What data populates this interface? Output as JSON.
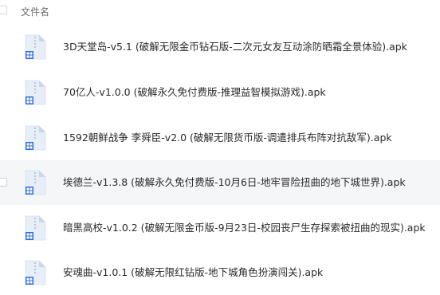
{
  "header": {
    "column_label": "文件名"
  },
  "files": [
    {
      "name": "3D天堂岛-v5.1 (破解无限金币钻石版-二次元女友互动涂防晒霜全景体验).apk",
      "icon": "apk-file-icon"
    },
    {
      "name": "70亿人-v1.0.0 (破解永久免付费版-推理益智模拟游戏).apk",
      "icon": "apk-file-icon"
    },
    {
      "name": "1592朝鲜战争 李舜臣-v2.0 (破解无限货币版-调遣排兵布阵对抗敌军).apk",
      "icon": "apk-file-icon"
    },
    {
      "name": "埃德兰-v1.3.8 (破解永久免付费版-10月6日-地牢冒险扭曲的地下城世界).apk",
      "icon": "apk-file-icon"
    },
    {
      "name": "暗黑高校-v1.0.2 (破解无限金币版-9月23日-校园丧尸生存探索被扭曲的现实).apk",
      "icon": "apk-file-icon"
    },
    {
      "name": "安魂曲-v1.0.1 (破解无限红钻版-地下城角色扮演闯关).apk",
      "icon": "apk-file-icon"
    }
  ],
  "colors": {
    "icon_body": "#e8eef8",
    "icon_fold": "#c9d7ee",
    "icon_glyph": "#2f6fdc",
    "row_hover": "#f5f6f8"
  }
}
